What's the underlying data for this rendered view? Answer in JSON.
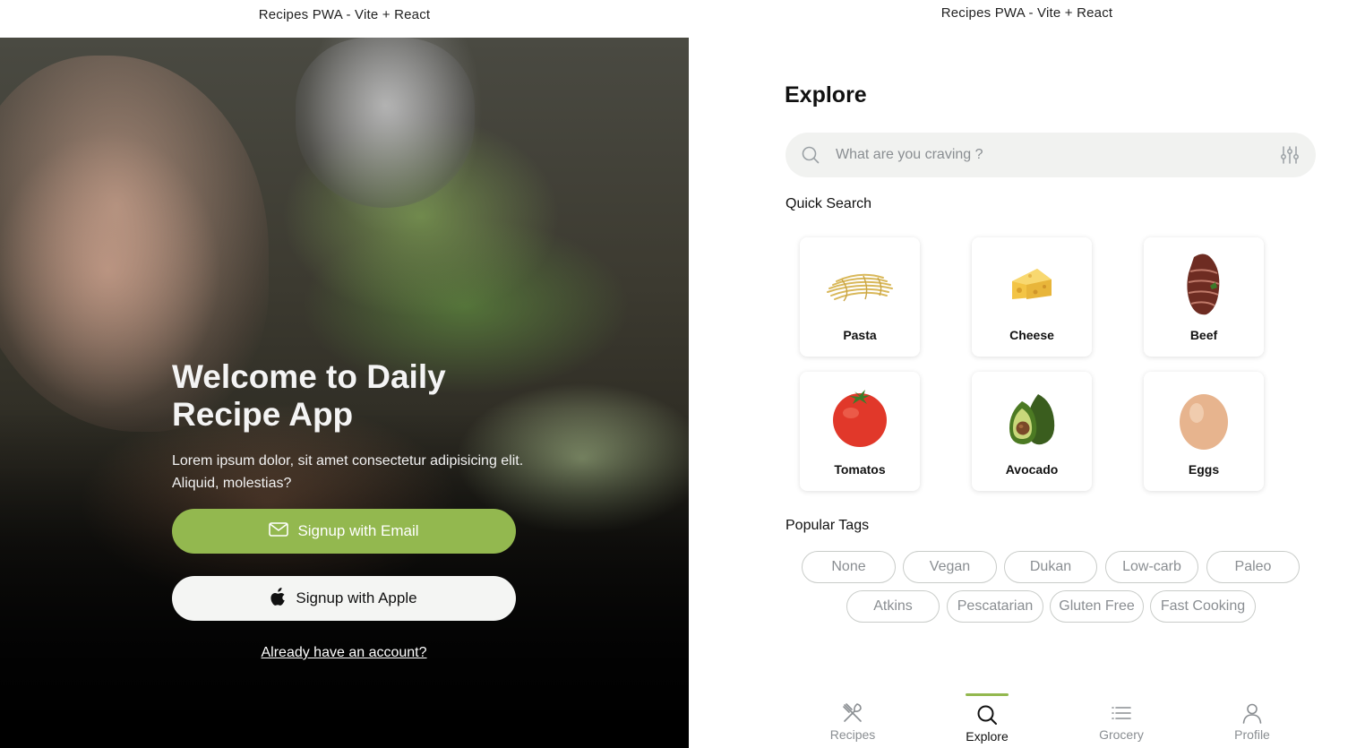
{
  "window": {
    "left_title": "Recipes PWA - Vite + React",
    "right_title": "Recipes PWA - Vite + React"
  },
  "welcome": {
    "heading": "Welcome to Daily Recipe App",
    "subtitle": "Lorem ipsum dolor, sit amet consectetur adipisicing elit. Aliquid, molestias?",
    "email_button": "Signup with Email",
    "apple_button": "Signup with Apple",
    "account_link": "Already have an account?",
    "accent_color": "#93b84f"
  },
  "explore": {
    "title": "Explore",
    "search": {
      "placeholder": "What are you craving ?",
      "value": ""
    },
    "quick_search_label": "Quick Search",
    "quick_items": [
      {
        "label": "Pasta",
        "icon": "pasta-icon"
      },
      {
        "label": "Cheese",
        "icon": "cheese-icon"
      },
      {
        "label": "Beef",
        "icon": "beef-icon"
      },
      {
        "label": "Tomatos",
        "icon": "tomato-icon"
      },
      {
        "label": "Avocado",
        "icon": "avocado-icon"
      },
      {
        "label": "Eggs",
        "icon": "egg-icon"
      }
    ],
    "popular_tags_label": "Popular Tags",
    "tags": [
      "None",
      "Vegan",
      "Dukan",
      "Low-carb",
      "Paleo",
      "Atkins",
      "Pescatarian",
      "Gluten Free",
      "Fast Cooking"
    ]
  },
  "nav": {
    "items": [
      {
        "label": "Recipes",
        "icon": "fork-knife-icon",
        "active": false
      },
      {
        "label": "Explore",
        "icon": "search-icon",
        "active": true
      },
      {
        "label": "Grocery",
        "icon": "list-icon",
        "active": false
      },
      {
        "label": "Profile",
        "icon": "user-icon",
        "active": false
      }
    ]
  }
}
